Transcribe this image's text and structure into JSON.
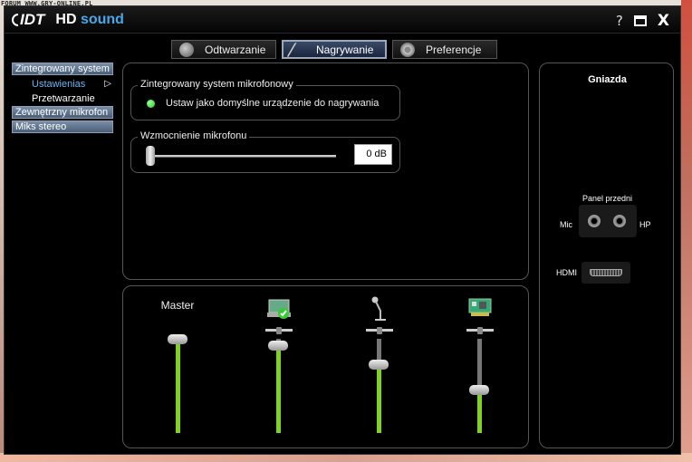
{
  "watermark": "FORUM WWW.GRY-ONLINE.PL",
  "titlebar": {
    "brand": "IDT",
    "product_prefix": "HD",
    "product_suffix": "sound",
    "help": "?",
    "close": "X"
  },
  "tabs": [
    {
      "label": "Odtwarzanie",
      "icon": "speaker-icon",
      "active": false
    },
    {
      "label": "Nagrywanie",
      "icon": "microphone-icon",
      "active": true
    },
    {
      "label": "Preferencje",
      "icon": "gear-icon",
      "active": false
    }
  ],
  "sidebar": {
    "items": [
      {
        "label": "Zintegrowany system"
      },
      {
        "label": "Zewnętrzny mikrofon"
      },
      {
        "label": "Miks stereo"
      }
    ],
    "subitems": [
      {
        "label": "Ustawienias",
        "selected": true
      },
      {
        "label": "Przetwarzanie",
        "selected": false
      }
    ],
    "arrow": "▷"
  },
  "main": {
    "mic_group_title": "Zintegrowany system mikrofonowy",
    "default_label": "Ustaw jako domyślne urządzenie do nagrywania",
    "gain_group_title": "Wzmocnienie mikrofonu",
    "gain_value": "0 dB",
    "gain_level": 0
  },
  "mixer": {
    "master_label": "Master",
    "channels": [
      {
        "name": "master",
        "level": 1.0
      },
      {
        "name": "wave-in",
        "icon": "recording-device-icon",
        "level": 0.93
      },
      {
        "name": "microphone",
        "icon": "microphone-stand-icon",
        "level": 0.73
      },
      {
        "name": "line-in",
        "icon": "sound-card-icon",
        "level": 0.46
      }
    ],
    "colors": {
      "fill": "#7ed321",
      "track": "#777777"
    }
  },
  "jacks": {
    "title": "Gniazda",
    "panel_front": "Panel przedni",
    "mic": "Mic",
    "hp": "HP",
    "hdmi": "HDMI"
  }
}
